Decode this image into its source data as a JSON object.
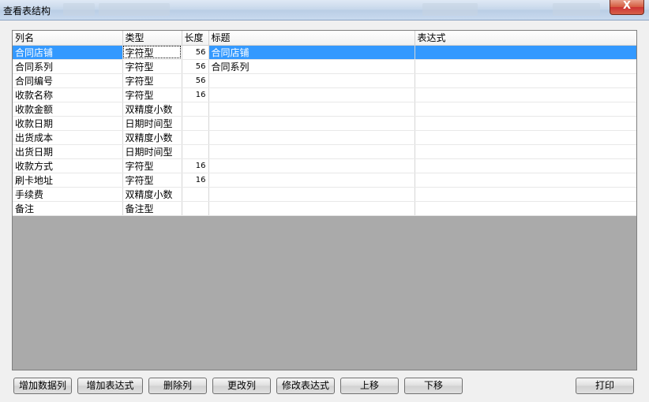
{
  "window": {
    "title": "查看表结构",
    "close_label": "X"
  },
  "grid": {
    "columns": [
      "列名",
      "类型",
      "长度",
      "标题",
      "表达式"
    ],
    "rows": [
      {
        "name": "合同店铺",
        "type": "字符型",
        "length": "56",
        "caption": "合同店铺",
        "expr": ""
      },
      {
        "name": "合同系列",
        "type": "字符型",
        "length": "56",
        "caption": "合同系列",
        "expr": ""
      },
      {
        "name": "合同编号",
        "type": "字符型",
        "length": "56",
        "caption": "",
        "expr": ""
      },
      {
        "name": "收款名称",
        "type": "字符型",
        "length": "16",
        "caption": "",
        "expr": ""
      },
      {
        "name": "收款金额",
        "type": "双精度小数",
        "length": "",
        "caption": "",
        "expr": ""
      },
      {
        "name": "收款日期",
        "type": "日期时间型",
        "length": "",
        "caption": "",
        "expr": ""
      },
      {
        "name": "出货成本",
        "type": "双精度小数",
        "length": "",
        "caption": "",
        "expr": ""
      },
      {
        "name": "出货日期",
        "type": "日期时间型",
        "length": "",
        "caption": "",
        "expr": ""
      },
      {
        "name": "收款方式",
        "type": "字符型",
        "length": "16",
        "caption": "",
        "expr": ""
      },
      {
        "name": "刷卡地址",
        "type": "字符型",
        "length": "16",
        "caption": "",
        "expr": ""
      },
      {
        "name": "手续费",
        "type": "双精度小数",
        "length": "",
        "caption": "",
        "expr": ""
      },
      {
        "name": "备注",
        "type": "备注型",
        "length": "",
        "caption": "",
        "expr": ""
      }
    ]
  },
  "buttons": {
    "add_data_column": "增加数据列",
    "add_expression": "增加表达式",
    "delete_column": "删除列",
    "change_column": "更改列",
    "edit_expression": "修改表达式",
    "move_up": "上移",
    "move_down": "下移",
    "print": "打印"
  }
}
